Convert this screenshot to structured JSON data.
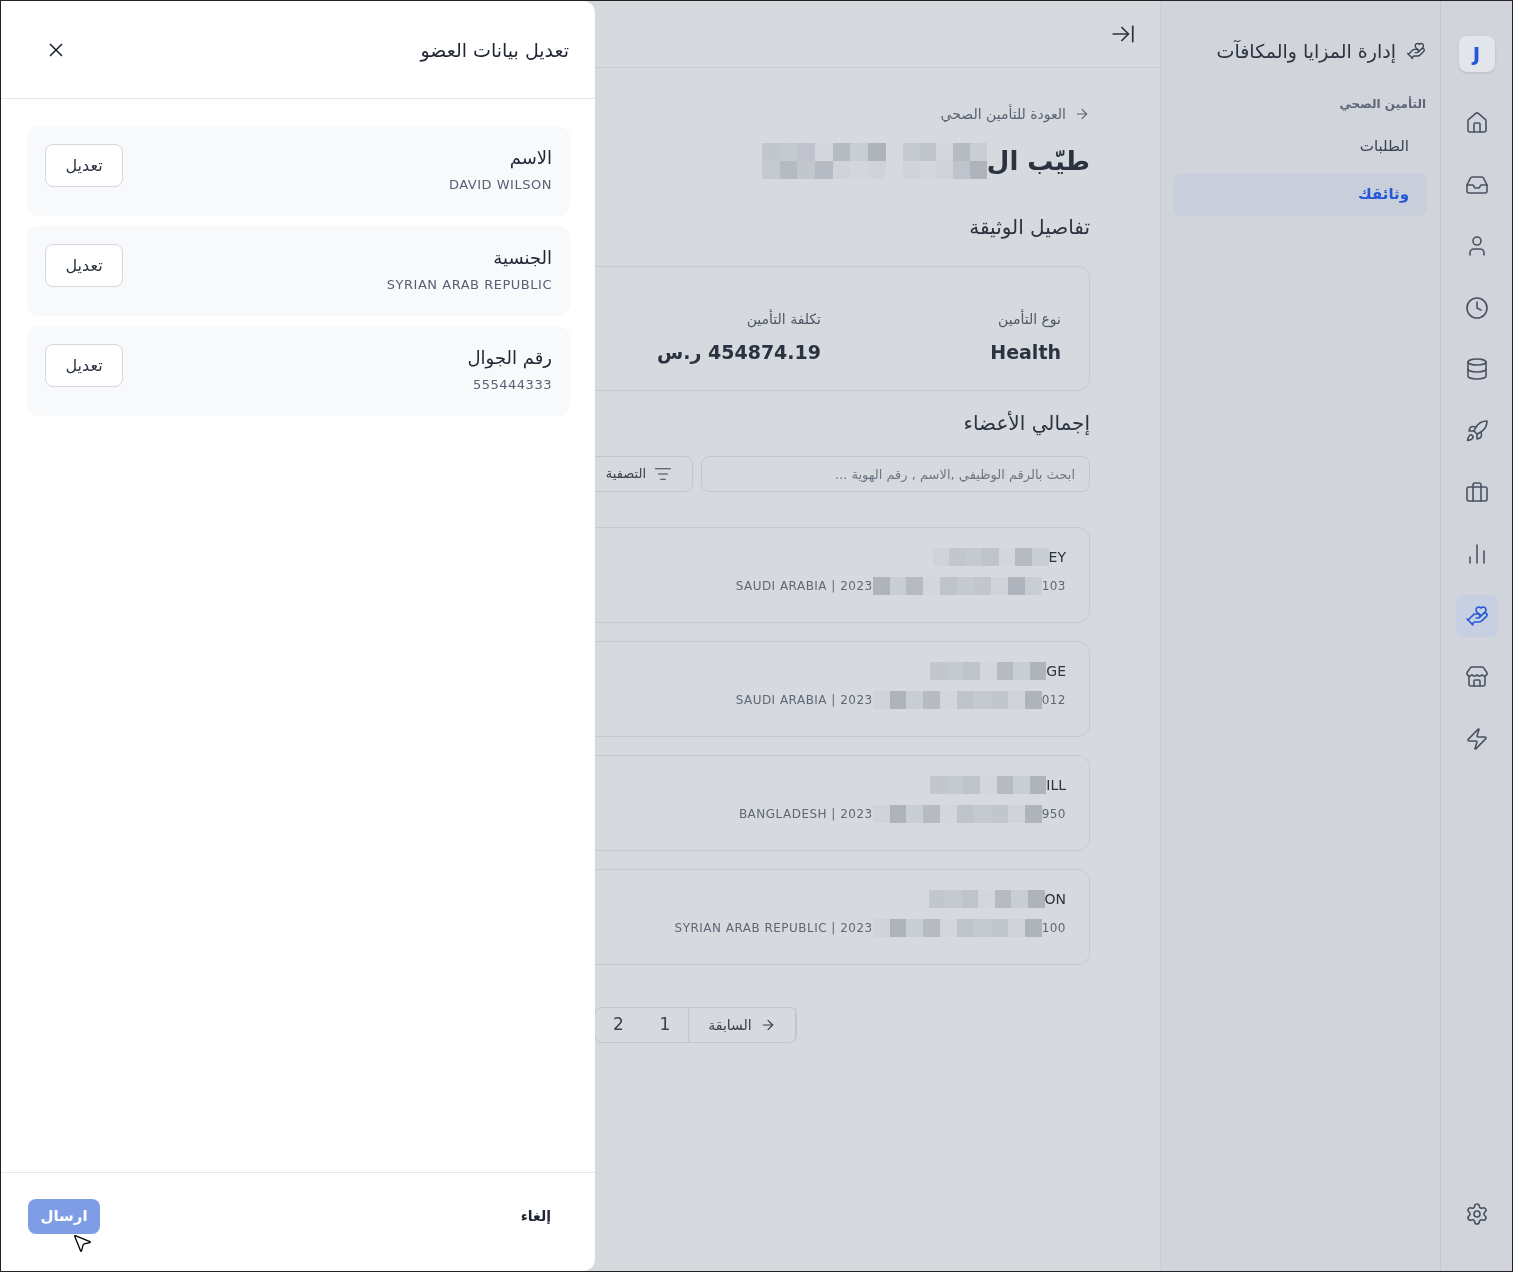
{
  "rail": {
    "logo": "J",
    "items": [
      {
        "selected": false
      },
      {
        "selected": false
      },
      {
        "selected": false
      },
      {
        "selected": false
      },
      {
        "selected": false
      },
      {
        "selected": false
      },
      {
        "selected": false
      },
      {
        "selected": false
      },
      {
        "selected": true
      },
      {
        "selected": false
      },
      {
        "selected": false
      }
    ]
  },
  "sidebar": {
    "title": "إدارة المزايا والمكافآت",
    "section": "التأمين الصحي",
    "items": [
      {
        "label": "الطلبات",
        "selected": false
      },
      {
        "label": "وثائقك",
        "selected": true
      }
    ]
  },
  "main": {
    "back_link": "العودة للتأمين الصحي",
    "title": "طيّب ال",
    "details_heading": "تفاصيل الوثيقة",
    "details": [
      {
        "label": "نوع التأمين",
        "value": "Health"
      },
      {
        "label": "تكلفة التأمين",
        "value": "454874.19 ر.س"
      }
    ],
    "members_heading": "إجمالي الأعضاء",
    "search": {
      "placeholder": "ابحث بالرقم الوظيفي ,الاسم , رقم الهوية ..."
    },
    "filter_button": "التصفية",
    "members": [
      {
        "name_tail": "EY",
        "subtitle_start": "SAUDI ARABIA | 2023",
        "subtitle_end": "103"
      },
      {
        "name_tail": "GE",
        "subtitle_start": "SAUDI ARABIA | 2023",
        "subtitle_end": "012"
      },
      {
        "name_tail": "ILL",
        "subtitle_start": "BANGLADESH | 2023",
        "subtitle_end": "950"
      },
      {
        "name_tail": "ON",
        "subtitle_start": "SYRIAN ARAB REPUBLIC | 2023",
        "subtitle_end": "100"
      }
    ],
    "pagination": [
      {
        "kind": "prev",
        "label": "السابقة"
      },
      {
        "kind": "page",
        "label": "1"
      },
      {
        "kind": "page",
        "label": "2"
      }
    ]
  },
  "drawer": {
    "title": "تعديل بيانات العضو",
    "fields": [
      {
        "label": "الاسم",
        "value": "DAVID WILSON",
        "button": "تعديل"
      },
      {
        "label": "الجنسية",
        "value": "SYRIAN ARAB REPUBLIC",
        "button": "تعديل"
      },
      {
        "label": "رقم الجوال",
        "value": "555444333",
        "button": "تعديل"
      }
    ],
    "cancel": "إلغاء",
    "submit": {
      "label": "ارسال",
      "disabled": true
    }
  }
}
